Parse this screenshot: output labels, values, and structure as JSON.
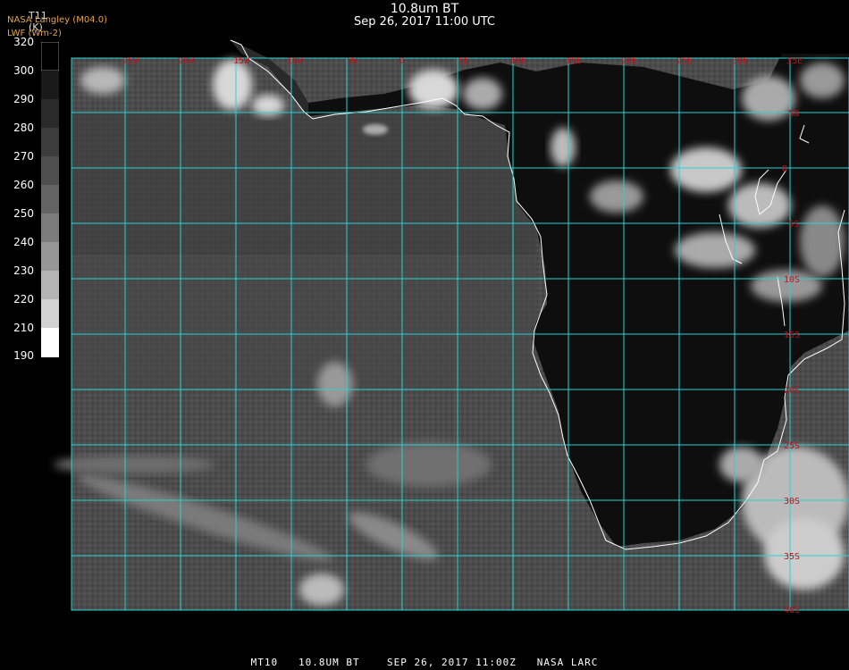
{
  "header": {
    "title": "10.8um BT",
    "subtitle": "Sep 26, 2017 11:00 UTC",
    "credit_line1": "NASA Langley (M04.0)",
    "credit_line2": "LWF (Wm-2)"
  },
  "legend": {
    "variable": "T11",
    "unit": "(K)",
    "ticks": [
      "320",
      "300",
      "290",
      "280",
      "270",
      "260",
      "250",
      "240",
      "230",
      "220",
      "210",
      "190"
    ]
  },
  "map": {
    "lon_labels": [
      "25W",
      "20W",
      "15W",
      "10W",
      "5W",
      "0",
      "5E",
      "10E",
      "15E",
      "20E",
      "25E",
      "30E",
      "35E"
    ],
    "lat_labels": [
      "5N",
      "0",
      "5S",
      "10S",
      "15S",
      "20S",
      "25S",
      "30S",
      "35S",
      "40S"
    ],
    "grid_color": "#28d4d4",
    "label_color": "#c0121a",
    "coast_color": "#ffffff"
  },
  "footer": {
    "text": "MT10   10.8UM BT    SEP 26, 2017 11:00Z   NASA LARC"
  }
}
